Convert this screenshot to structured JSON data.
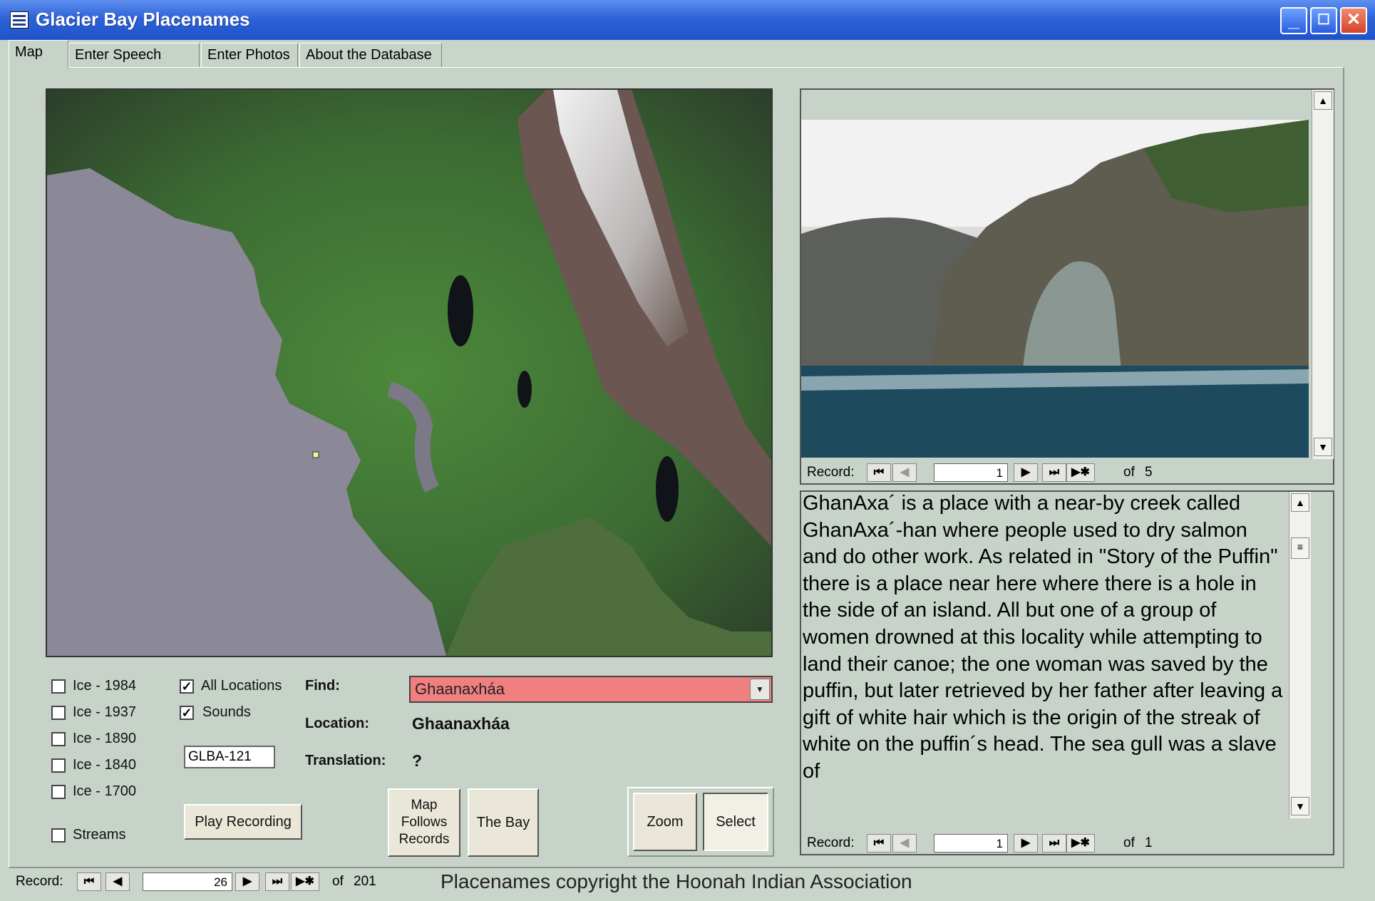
{
  "window": {
    "title": "Glacier Bay Placenames"
  },
  "tabs": [
    {
      "label": "Map"
    },
    {
      "label": "Enter Speech Files"
    },
    {
      "label": "Enter Photos"
    },
    {
      "label": "About the Database"
    }
  ],
  "layers": {
    "ice_1984": "Ice - 1984",
    "ice_1937": "Ice - 1937",
    "ice_1890": "Ice - 1890",
    "ice_1840": "Ice - 1840",
    "ice_1700": "Ice - 1700",
    "streams": "Streams"
  },
  "options": {
    "all_locations": "All Locations",
    "sounds": "Sounds",
    "all_locations_checked": true,
    "sounds_checked": true
  },
  "code": "GLBA-121",
  "buttons": {
    "play": "Play Recording",
    "map_follows_line1": "Map",
    "map_follows_line2": "Follows",
    "map_follows_line3": "Records",
    "the_bay": "The Bay",
    "zoom": "Zoom",
    "select": "Select"
  },
  "fields": {
    "find_label": "Find:",
    "find_value": "Ghaanaxháa",
    "location_label": "Location:",
    "location_value": "Ghaanaxháa",
    "translation_label": "Translation:",
    "translation_value": "?"
  },
  "photo_nav": {
    "label": "Record:",
    "current": "1",
    "of": "of",
    "total": "5"
  },
  "desc_nav": {
    "label": "Record:",
    "current": "1",
    "of": "of",
    "total": "1"
  },
  "main_nav": {
    "label": "Record:",
    "current": "26",
    "of": "of",
    "total": "201"
  },
  "description": "GhanAxa´ is a place with a near-by creek called GhanAxa´-han where people used to dry salmon and do other work.  As related in \"Story of the Puffin\" there is a place near here where there is a hole in the side of an island.  All but one of a group of women drowned at this locality while attempting to land their canoe; the one woman was saved by the puffin, but later retrieved by her father after leaving a gift of white hair which is the origin of the streak of white on the puffin´s head.  The sea gull was a slave of",
  "footer": "Placenames copyright the Hoonah Indian Association",
  "icons": {
    "first": "⏮",
    "prev": "◀",
    "next": "▶",
    "last": "⏭",
    "new": "▶✱"
  }
}
